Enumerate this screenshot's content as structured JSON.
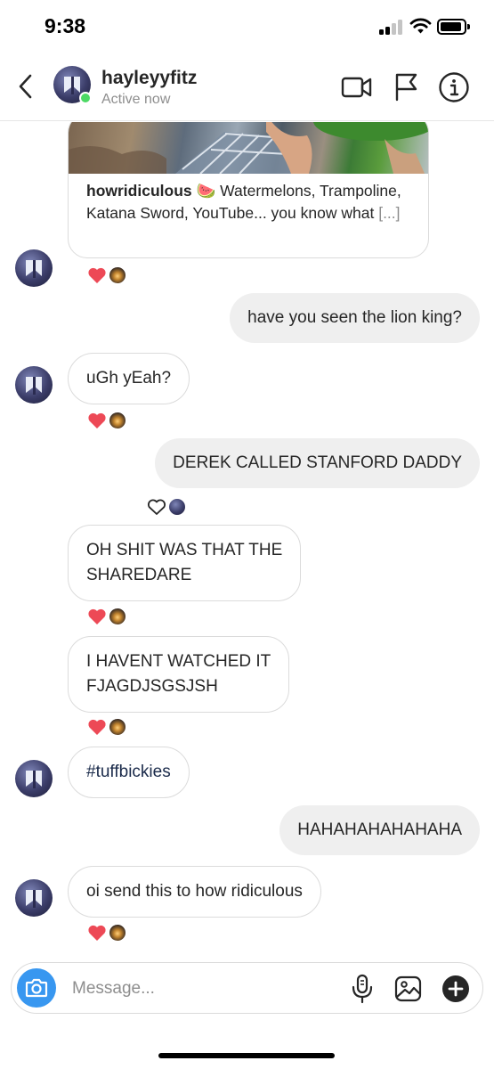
{
  "status_bar": {
    "time": "9:38"
  },
  "header": {
    "username": "hayleyyfitz",
    "status": "Active now",
    "icons": [
      "chevron-left-icon",
      "video-camera-icon",
      "flag-icon",
      "info-icon"
    ]
  },
  "shared_post": {
    "username": "howridiculous",
    "emoji": "🍉",
    "caption": "Watermelons, Trampoline, Katana Sword, YouTube... you know what",
    "more": "[...]"
  },
  "messages": [
    {
      "direction": "out",
      "text": "have you seen the lion king?"
    },
    {
      "direction": "in",
      "text": "uGh yEah?"
    },
    {
      "direction": "out",
      "text": "DEREK CALLED STANFORD DADDY"
    },
    {
      "direction": "in",
      "line1": "OH SHIT WAS THAT THE",
      "line2": "SHAREDARE"
    },
    {
      "direction": "in",
      "line1": "I HAVENT WATCHED IT",
      "line2": "FJAGDJSGSJSH"
    },
    {
      "direction": "in",
      "text": "#tuffbickies"
    },
    {
      "direction": "out",
      "text": "HAHAHAHAHAHAHA"
    },
    {
      "direction": "in",
      "text": "oi send this to how ridiculous"
    }
  ],
  "composer": {
    "placeholder": "Message..."
  },
  "colors": {
    "accent": "#3897f0",
    "heart": "#ed4956",
    "active": "#4cd964"
  }
}
